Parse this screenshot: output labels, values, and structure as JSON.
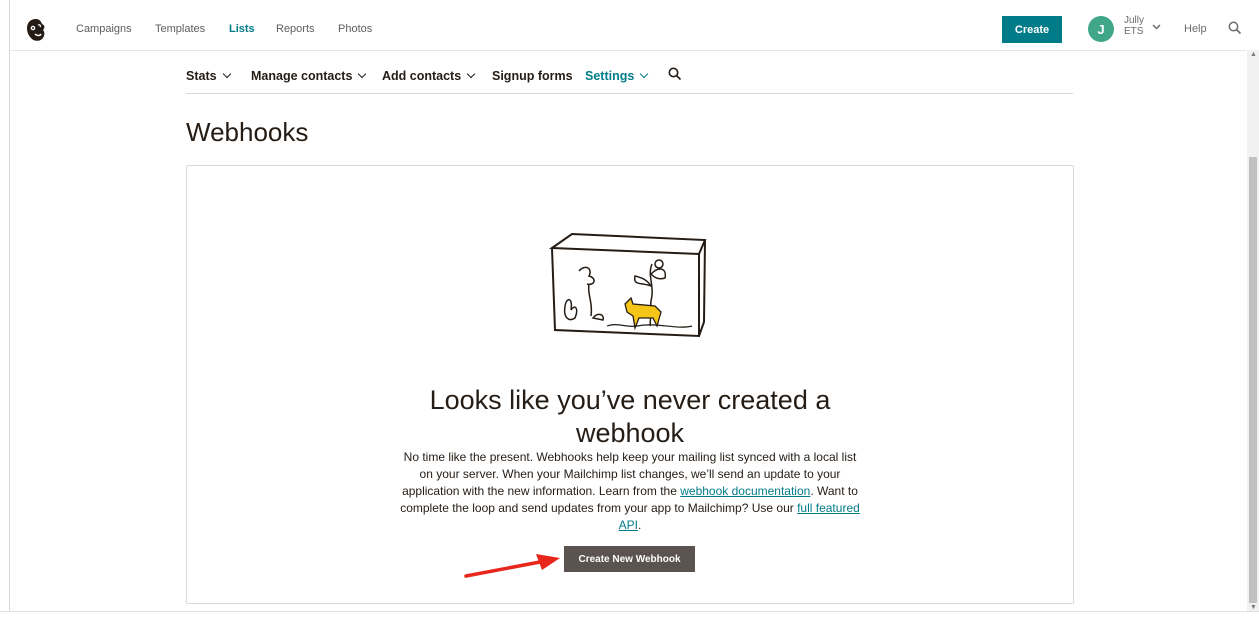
{
  "topbar": {
    "nav": [
      {
        "label": "Campaigns",
        "active": false
      },
      {
        "label": "Templates",
        "active": false
      },
      {
        "label": "Lists",
        "active": true
      },
      {
        "label": "Reports",
        "active": false
      },
      {
        "label": "Photos",
        "active": false
      }
    ],
    "create_label": "Create",
    "user": {
      "initial": "J",
      "name_line1": "Jully",
      "name_line2": "ETS"
    },
    "help_label": "Help"
  },
  "subnav": {
    "items": [
      {
        "label": "Stats",
        "has_dropdown": true,
        "active": false
      },
      {
        "label": "Manage contacts",
        "has_dropdown": true,
        "active": false
      },
      {
        "label": "Add contacts",
        "has_dropdown": true,
        "active": false
      },
      {
        "label": "Signup forms",
        "has_dropdown": false,
        "active": false
      },
      {
        "label": "Settings",
        "has_dropdown": true,
        "active": true
      }
    ]
  },
  "page": {
    "title": "Webhooks",
    "empty_state": {
      "heading": "Looks like you’ve never created a webhook",
      "body_part1": "No time like the present. Webhooks help keep your mailing list synced with a local list on your server. When your Mailchimp list changes, we’ll send an update to your application with the new information. Learn from the ",
      "link1": "webhook documentation",
      "body_part2": ". Want to complete the loop and send updates from your app to Mailchimp? Use our ",
      "link2": "full featured API",
      "body_part3": ".",
      "button_label": "Create New Webhook"
    }
  },
  "colors": {
    "brand_teal": "#007c89",
    "button_dark": "#5b5350",
    "avatar": "#3fa687",
    "arrow": "#e8261b"
  },
  "icons": [
    "mailchimp-logo",
    "search-icon",
    "chevron-down-icon",
    "terrarium-illustration",
    "red-arrow-annotation"
  ]
}
